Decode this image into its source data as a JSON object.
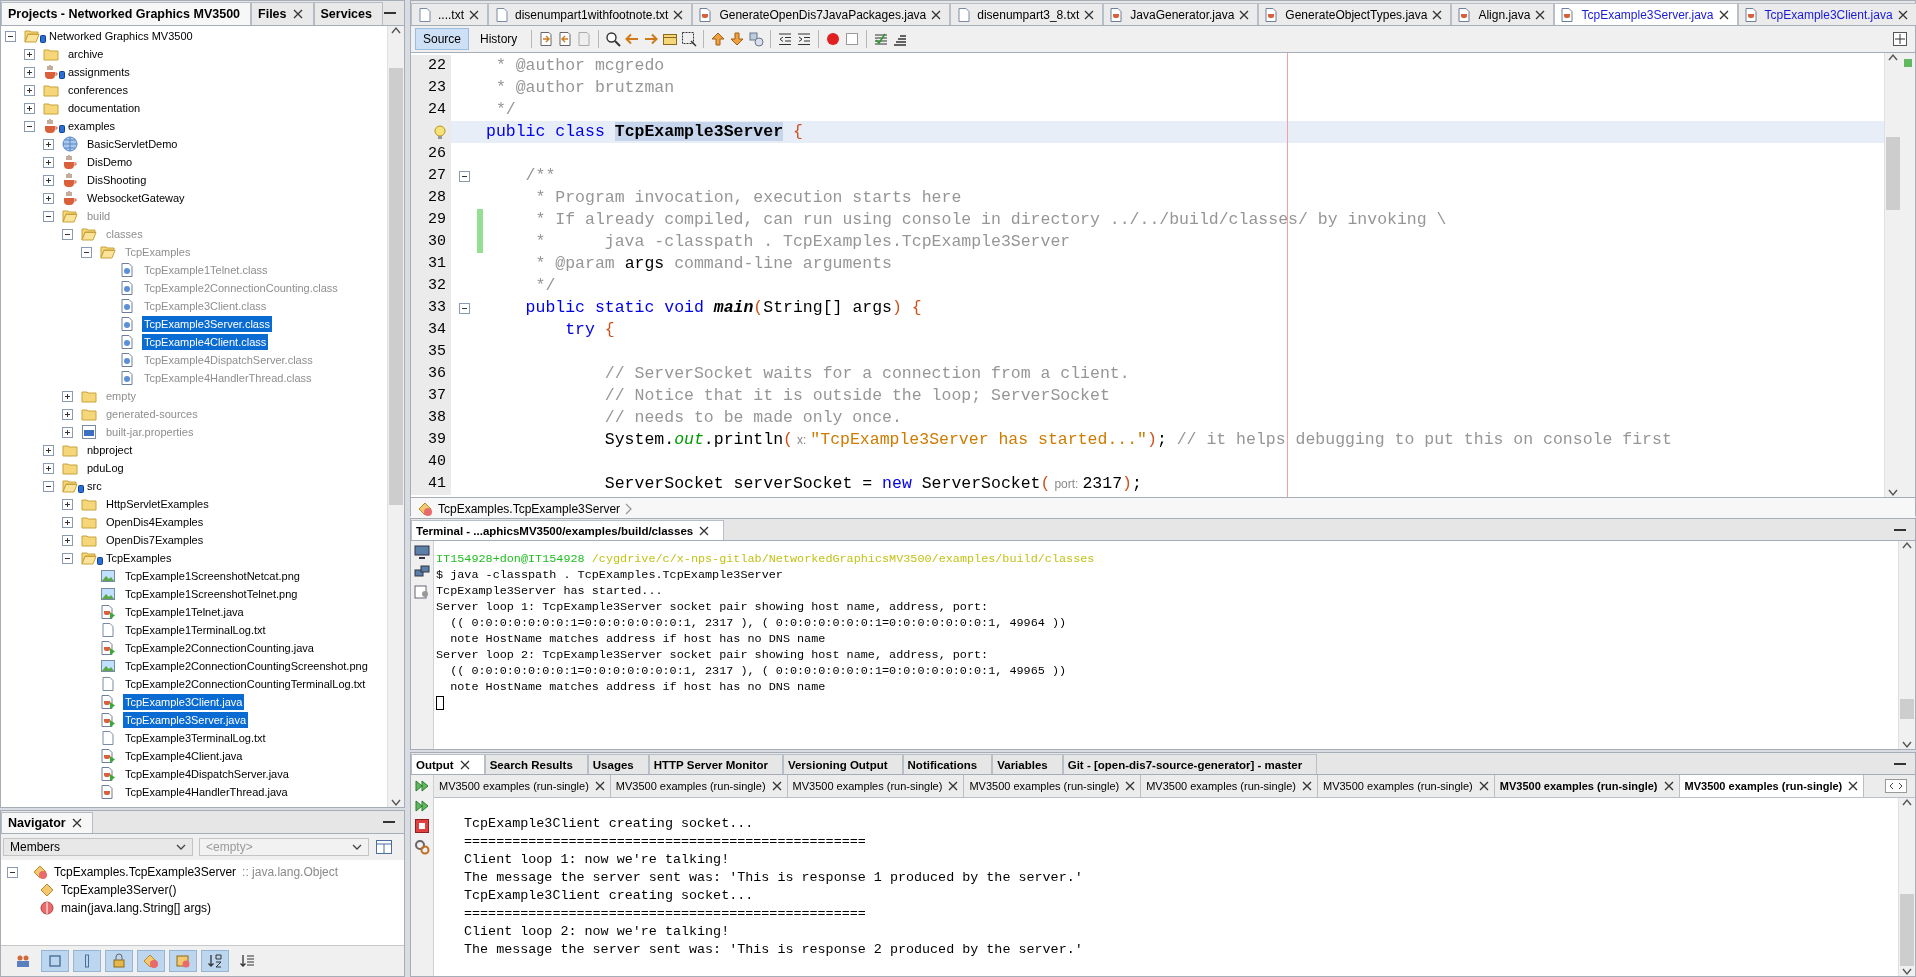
{
  "projects_panel": {
    "tabs": [
      {
        "label": "Projects - Networked Graphics MV3500",
        "selected": true,
        "closable": false
      },
      {
        "label": "Files",
        "selected": false,
        "closable": true
      },
      {
        "label": "Services",
        "selected": false,
        "closable": false
      }
    ],
    "tree": [
      {
        "label": "Networked Graphics MV3500",
        "kind": "folder",
        "expanded": true,
        "selected": false,
        "dimmed": false,
        "badge": true,
        "children": [
          {
            "label": "archive",
            "kind": "folder",
            "expanded": false,
            "selected": false,
            "dimmed": false,
            "badge": false
          },
          {
            "label": "assignments",
            "kind": "project",
            "expanded": false,
            "selected": false,
            "dimmed": false,
            "badge": true
          },
          {
            "label": "conferences",
            "kind": "folder",
            "expanded": false,
            "selected": false,
            "dimmed": false,
            "badge": false
          },
          {
            "label": "documentation",
            "kind": "folder",
            "expanded": false,
            "selected": false,
            "dimmed": false,
            "badge": false
          },
          {
            "label": "examples",
            "kind": "project",
            "expanded": true,
            "selected": false,
            "dimmed": false,
            "badge": true,
            "children": [
              {
                "label": "BasicServletDemo",
                "kind": "web",
                "expanded": false,
                "selected": false,
                "dimmed": false,
                "badge": false
              },
              {
                "label": "DisDemo",
                "kind": "project",
                "expanded": false,
                "selected": false,
                "dimmed": false,
                "badge": false
              },
              {
                "label": "DisShooting",
                "kind": "project",
                "expanded": false,
                "selected": false,
                "dimmed": false,
                "badge": false
              },
              {
                "label": "WebsocketGateway",
                "kind": "project",
                "expanded": false,
                "selected": false,
                "dimmed": false,
                "badge": false
              },
              {
                "label": "build",
                "kind": "folder",
                "expanded": true,
                "selected": false,
                "dimmed": true,
                "badge": false,
                "children": [
                  {
                    "label": "classes",
                    "kind": "folder",
                    "expanded": true,
                    "selected": false,
                    "dimmed": true,
                    "badge": false,
                    "children": [
                      {
                        "label": "TcpExamples",
                        "kind": "folder",
                        "expanded": true,
                        "selected": false,
                        "dimmed": true,
                        "badge": false,
                        "children": [
                          {
                            "label": "TcpExample1Telnet.class",
                            "kind": "class",
                            "selected": false,
                            "dimmed": true,
                            "badge": false
                          },
                          {
                            "label": "TcpExample2ConnectionCounting.class",
                            "kind": "class",
                            "selected": false,
                            "dimmed": true,
                            "badge": false
                          },
                          {
                            "label": "TcpExample3Client.class",
                            "kind": "class",
                            "selected": false,
                            "dimmed": true,
                            "badge": false
                          },
                          {
                            "label": "TcpExample3Server.class",
                            "kind": "class",
                            "selected": true,
                            "dimmed": true,
                            "badge": false
                          },
                          {
                            "label": "TcpExample4Client.class",
                            "kind": "class",
                            "selected": true,
                            "dimmed": true,
                            "badge": false
                          },
                          {
                            "label": "TcpExample4DispatchServer.class",
                            "kind": "class",
                            "selected": false,
                            "dimmed": true,
                            "badge": false
                          },
                          {
                            "label": "TcpExample4HandlerThread.class",
                            "kind": "class",
                            "selected": false,
                            "dimmed": true,
                            "badge": false
                          }
                        ]
                      }
                    ]
                  },
                  {
                    "label": "empty",
                    "kind": "folder",
                    "expanded": false,
                    "selected": false,
                    "dimmed": true,
                    "badge": false
                  },
                  {
                    "label": "generated-sources",
                    "kind": "folder",
                    "expanded": false,
                    "selected": false,
                    "dimmed": true,
                    "badge": false
                  },
                  {
                    "label": "built-jar.properties",
                    "kind": "properties",
                    "expanded": false,
                    "selected": false,
                    "dimmed": true,
                    "badge": false
                  }
                ]
              },
              {
                "label": "nbproject",
                "kind": "folder",
                "expanded": false,
                "selected": false,
                "dimmed": false,
                "badge": false
              },
              {
                "label": "pduLog",
                "kind": "folder",
                "expanded": false,
                "selected": false,
                "dimmed": false,
                "badge": false
              },
              {
                "label": "src",
                "kind": "folder",
                "expanded": true,
                "selected": false,
                "dimmed": false,
                "badge": true,
                "children": [
                  {
                    "label": "HttpServletExamples",
                    "kind": "folder",
                    "expanded": false,
                    "selected": false,
                    "dimmed": false,
                    "badge": false
                  },
                  {
                    "label": "OpenDis4Examples",
                    "kind": "folder",
                    "expanded": false,
                    "selected": false,
                    "dimmed": false,
                    "badge": false
                  },
                  {
                    "label": "OpenDis7Examples",
                    "kind": "folder",
                    "expanded": false,
                    "selected": false,
                    "dimmed": false,
                    "badge": false
                  },
                  {
                    "label": "TcpExamples",
                    "kind": "folder",
                    "expanded": true,
                    "selected": false,
                    "dimmed": false,
                    "badge": true,
                    "children": [
                      {
                        "label": "TcpExample1ScreenshotNetcat.png",
                        "kind": "image",
                        "selected": false,
                        "dimmed": false,
                        "badge": false
                      },
                      {
                        "label": "TcpExample1ScreenshotTelnet.png",
                        "kind": "image",
                        "selected": false,
                        "dimmed": false,
                        "badge": false
                      },
                      {
                        "label": "TcpExample1Telnet.java",
                        "kind": "java-main",
                        "selected": false,
                        "dimmed": false,
                        "badge": false
                      },
                      {
                        "label": "TcpExample1TerminalLog.txt",
                        "kind": "text",
                        "selected": false,
                        "dimmed": false,
                        "badge": false
                      },
                      {
                        "label": "TcpExample2ConnectionCounting.java",
                        "kind": "java-main",
                        "selected": false,
                        "dimmed": false,
                        "badge": false
                      },
                      {
                        "label": "TcpExample2ConnectionCountingScreenshot.png",
                        "kind": "image",
                        "selected": false,
                        "dimmed": false,
                        "badge": false
                      },
                      {
                        "label": "TcpExample2ConnectionCountingTerminalLog.txt",
                        "kind": "text",
                        "selected": false,
                        "dimmed": false,
                        "badge": false
                      },
                      {
                        "label": "TcpExample3Client.java",
                        "kind": "java-main",
                        "selected": true,
                        "dimmed": false,
                        "badge": false
                      },
                      {
                        "label": "TcpExample3Server.java",
                        "kind": "java-main",
                        "selected": true,
                        "dimmed": false,
                        "badge": false
                      },
                      {
                        "label": "TcpExample3TerminalLog.txt",
                        "kind": "text",
                        "selected": false,
                        "dimmed": false,
                        "badge": false
                      },
                      {
                        "label": "TcpExample4Client.java",
                        "kind": "java-main",
                        "selected": false,
                        "dimmed": false,
                        "badge": false
                      },
                      {
                        "label": "TcpExample4DispatchServer.java",
                        "kind": "java-main",
                        "selected": false,
                        "dimmed": false,
                        "badge": false
                      },
                      {
                        "label": "TcpExample4HandlerThread.java",
                        "kind": "java",
                        "selected": false,
                        "dimmed": false,
                        "badge": false
                      }
                    ]
                  }
                ]
              }
            ]
          }
        ]
      }
    ]
  },
  "navigator": {
    "title": "Navigator",
    "members_filter": "Members",
    "second_filter": {
      "value": "<empty>",
      "disabled": true
    },
    "tree": [
      {
        "name": "TcpExamples.TcpExample3Server",
        "detail": ":: java.lang.Object",
        "kind": "class",
        "expanded": true,
        "children": [
          {
            "name": "TcpExample3Server()",
            "kind": "constructor"
          },
          {
            "name": "main(java.lang.String[] args)",
            "kind": "method"
          }
        ]
      }
    ],
    "filter_buttons": [
      {
        "pressed": false
      },
      {
        "pressed": true
      },
      {
        "pressed": true
      },
      {
        "pressed": true
      },
      {
        "pressed": true
      },
      {
        "pressed": true
      },
      {
        "pressed": true
      },
      {
        "pressed": false
      }
    ]
  },
  "editor": {
    "tabs": [
      {
        "label": "....txt",
        "kind": "text",
        "selected": false,
        "modified": false
      },
      {
        "label": "disenumpart1withfootnote.txt",
        "kind": "text",
        "selected": false,
        "modified": false
      },
      {
        "label": "GenerateOpenDis7JavaPackages.java",
        "kind": "java",
        "selected": false,
        "modified": false
      },
      {
        "label": "disenumpart3_8.txt",
        "kind": "text",
        "selected": false,
        "modified": false
      },
      {
        "label": "JavaGenerator.java",
        "kind": "java",
        "selected": false,
        "modified": false
      },
      {
        "label": "GenerateObjectTypes.java",
        "kind": "java",
        "selected": false,
        "modified": false
      },
      {
        "label": "Align.java",
        "kind": "java",
        "selected": false,
        "modified": false
      },
      {
        "label": "TcpExample3Server.java",
        "kind": "java",
        "selected": true,
        "modified": true
      },
      {
        "label": "TcpExample3Client.java",
        "kind": "java",
        "selected": false,
        "modified": true
      }
    ],
    "views": [
      {
        "label": "Source",
        "selected": true
      },
      {
        "label": "History",
        "selected": false
      }
    ],
    "lines": [
      {
        "number": "22",
        "current": false,
        "fold": false,
        "changed": false,
        "segments": [
          {
            "kind": "comment",
            "text": " * @author mcgredo"
          }
        ]
      },
      {
        "number": "23",
        "current": false,
        "fold": false,
        "changed": false,
        "segments": [
          {
            "kind": "comment",
            "text": " * @author brutzman"
          }
        ]
      },
      {
        "number": "24",
        "current": false,
        "fold": false,
        "changed": false,
        "segments": [
          {
            "kind": "comment",
            "text": " */"
          }
        ]
      },
      {
        "current": true,
        "fold": false,
        "changed": false,
        "segments": [
          {
            "kind": "keyword",
            "text": "public class "
          },
          {
            "kind": "declaration",
            "text": "TcpExample3Server"
          },
          {
            "kind": "bracket",
            "text": " {"
          }
        ]
      },
      {
        "number": "26",
        "current": false,
        "fold": false,
        "changed": false
      },
      {
        "number": "27",
        "current": false,
        "fold": true,
        "changed": false,
        "segments": [
          {
            "kind": "comment",
            "text": "    /**"
          }
        ]
      },
      {
        "number": "28",
        "current": false,
        "fold": false,
        "changed": false,
        "segments": [
          {
            "kind": "comment",
            "text": "     * Program invocation, execution starts here"
          }
        ]
      },
      {
        "number": "29",
        "current": false,
        "fold": false,
        "changed": true,
        "segments": [
          {
            "kind": "comment",
            "text": "     * If already compiled, can run using console in directory ../../build/classes/ by invoking \\"
          }
        ]
      },
      {
        "number": "30",
        "current": false,
        "fold": false,
        "changed": true,
        "segments": [
          {
            "kind": "comment",
            "text": "     *      java -classpath . TcpExamples.TcpExample3Server"
          }
        ]
      },
      {
        "number": "31",
        "current": false,
        "fold": false,
        "changed": false,
        "segments": [
          {
            "kind": "comment",
            "text": "     * @param "
          },
          {
            "kind": "plain",
            "text": "args"
          },
          {
            "kind": "comment",
            "text": " command-line arguments"
          }
        ]
      },
      {
        "number": "32",
        "current": false,
        "fold": false,
        "changed": false,
        "segments": [
          {
            "kind": "comment",
            "text": "     */"
          }
        ]
      },
      {
        "number": "33",
        "current": false,
        "fold": true,
        "changed": false,
        "segments": [
          {
            "kind": "keyword",
            "text": "    public static void "
          },
          {
            "kind": "method",
            "text": "main"
          },
          {
            "kind": "bracket",
            "text": "("
          },
          {
            "kind": "plain",
            "text": "String[] args"
          },
          {
            "kind": "bracket",
            "text": ")"
          },
          {
            "kind": "bracket",
            "text": " {"
          }
        ]
      },
      {
        "number": "34",
        "current": false,
        "fold": false,
        "changed": false,
        "segments": [
          {
            "kind": "keyword",
            "text": "        try"
          },
          {
            "kind": "bracket",
            "text": " {"
          }
        ]
      },
      {
        "number": "35",
        "current": false,
        "fold": false,
        "changed": false
      },
      {
        "number": "36",
        "current": false,
        "fold": false,
        "changed": false,
        "segments": [
          {
            "kind": "comment",
            "text": "            // ServerSocket waits for a connection from a client."
          }
        ]
      },
      {
        "number": "37",
        "current": false,
        "fold": false,
        "changed": false,
        "segments": [
          {
            "kind": "comment",
            "text": "            // Notice that it is outside the loop; ServerSocket"
          }
        ]
      },
      {
        "number": "38",
        "current": false,
        "fold": false,
        "changed": false,
        "segments": [
          {
            "kind": "comment",
            "text": "            // needs to be made only once."
          }
        ]
      },
      {
        "number": "39",
        "current": false,
        "fold": false,
        "changed": false,
        "segments": [
          {
            "kind": "plain",
            "text": "            System."
          },
          {
            "kind": "field",
            "text": "out"
          },
          {
            "kind": "plain",
            "text": ".println"
          },
          {
            "kind": "bracket",
            "text": "("
          },
          {
            "kind": "hint",
            "text": "x:"
          },
          {
            "kind": "string",
            "text": "\"TcpExample3Server has started...\""
          },
          {
            "kind": "bracket",
            "text": ")"
          },
          {
            "kind": "plain",
            "text": "; "
          },
          {
            "kind": "comment",
            "text": "// it helps debugging to put this on console first"
          }
        ]
      },
      {
        "number": "40",
        "current": false,
        "fold": false,
        "changed": false
      },
      {
        "number": "41",
        "current": false,
        "fold": false,
        "changed": false,
        "segments": [
          {
            "kind": "plain",
            "text": "            ServerSocket serverSocket = "
          },
          {
            "kind": "keyword",
            "text": "new"
          },
          {
            "kind": "plain",
            "text": " ServerSocket"
          },
          {
            "kind": "bracket",
            "text": "("
          },
          {
            "kind": "hint",
            "text": "port:"
          },
          {
            "kind": "plain",
            "text": "2317"
          },
          {
            "kind": "bracket",
            "text": ")"
          },
          {
            "kind": "plain",
            "text": ";"
          }
        ]
      }
    ],
    "breadcrumb": "TcpExamples.TcpExample3Server"
  },
  "terminal": {
    "title": "Terminal - ...aphicsMV3500/examples/build/classes",
    "prompt": {
      "user": "IT154928+don@IT154928",
      "path": "/cygdrive/c/x-nps-gitlab/NetworkedGraphicsMV3500/examples/build/classes"
    },
    "lines": [
      "$ java -classpath . TcpExamples.TcpExample3Server",
      "TcpExample3Server has started...",
      "Server loop 1: TcpExample3Server socket pair showing host name, address, port:",
      "  (( 0:0:0:0:0:0:0:1=0:0:0:0:0:0:0:1, 2317 ), ( 0:0:0:0:0:0:0:1=0:0:0:0:0:0:0:1, 49964 ))",
      "  note HostName matches address if host has no DNS name",
      "Server loop 2: TcpExample3Server socket pair showing host name, address, port:",
      "  (( 0:0:0:0:0:0:0:1=0:0:0:0:0:0:0:1, 2317 ), ( 0:0:0:0:0:0:0:1=0:0:0:0:0:0:0:1, 49965 ))",
      "  note HostName matches address if host has no DNS name"
    ]
  },
  "output": {
    "tabs": [
      {
        "label": "Output",
        "selected": true,
        "closable": true
      },
      {
        "label": "Search Results",
        "selected": false,
        "closable": false
      },
      {
        "label": "Usages",
        "selected": false,
        "closable": false
      },
      {
        "label": "HTTP Server Monitor",
        "selected": false,
        "closable": false
      },
      {
        "label": "Versioning Output",
        "selected": false,
        "closable": false
      },
      {
        "label": "Notifications",
        "selected": false,
        "closable": false
      },
      {
        "label": "Variables",
        "selected": false,
        "closable": false
      },
      {
        "label": "Git -  [open-dis7-source-generator] - master",
        "selected": false,
        "closable": false
      }
    ],
    "runs": [
      {
        "label": "MV3500 examples (run-single)",
        "selected": false,
        "bold": false
      },
      {
        "label": "MV3500 examples (run-single)",
        "selected": false,
        "bold": false
      },
      {
        "label": "MV3500 examples (run-single)",
        "selected": false,
        "bold": false
      },
      {
        "label": "MV3500 examples (run-single)",
        "selected": false,
        "bold": false
      },
      {
        "label": "MV3500 examples (run-single)",
        "selected": false,
        "bold": false
      },
      {
        "label": "MV3500 examples (run-single)",
        "selected": false,
        "bold": false
      },
      {
        "label": "MV3500 examples (run-single)",
        "selected": false,
        "bold": true
      },
      {
        "label": "MV3500 examples (run-single)",
        "selected": true,
        "bold": true
      }
    ],
    "lines": [
      "TcpExample3Client creating socket...",
      "==================================================",
      "Client loop 1: now we're talking!",
      "The message the server sent was: 'This is response 1 produced by the server.'",
      "TcpExample3Client creating socket...",
      "==================================================",
      "Client loop 2: now we're talking!",
      "The message the server sent was: 'This is response 2 produced by the server.'"
    ]
  }
}
